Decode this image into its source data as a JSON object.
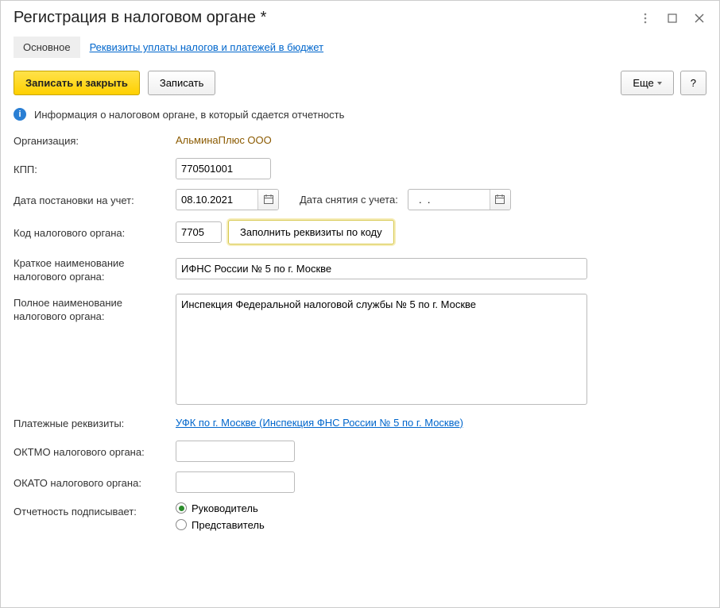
{
  "window": {
    "title": "Регистрация в налоговом органе *"
  },
  "tabs": {
    "main": "Основное",
    "payments_link": "Реквизиты уплаты налогов и платежей в бюджет"
  },
  "toolbar": {
    "save_close_label": "Записать и закрыть",
    "save_label": "Записать",
    "more_label": "Еще",
    "help_label": "?"
  },
  "info": {
    "message": "Информация о налоговом органе, в который сдается отчетность"
  },
  "fields": {
    "organization": {
      "label": "Организация:",
      "value": "АльминаПлюс ООО"
    },
    "kpp": {
      "label": "КПП:",
      "value": "770501001"
    },
    "registration_date": {
      "label": "Дата постановки на учет:",
      "value": "08.10.2021"
    },
    "deregistration_date": {
      "label": "Дата снятия с учета:",
      "value": "  .  .    "
    },
    "tax_code": {
      "label": "Код налогового органа:",
      "value": "7705",
      "fill_button": "Заполнить реквизиты по коду"
    },
    "short_name": {
      "label": "Краткое наименование налогового органа:",
      "value": "ИФНС России № 5 по г. Москве"
    },
    "full_name": {
      "label": "Полное наименование налогового органа:",
      "value": "Инспекция Федеральной налоговой службы № 5 по г. Москве"
    },
    "payment_details": {
      "label": "Платежные реквизиты:",
      "value": "УФК по г. Москве (Инспекция ФНС России № 5 по г. Москве)"
    },
    "oktmo": {
      "label": "ОКТМО налогового органа:",
      "value": ""
    },
    "okato": {
      "label": "ОКАТО налогового органа:",
      "value": ""
    },
    "signer": {
      "label": "Отчетность подписывает:",
      "option1": "Руководитель",
      "option2": "Представитель"
    }
  }
}
